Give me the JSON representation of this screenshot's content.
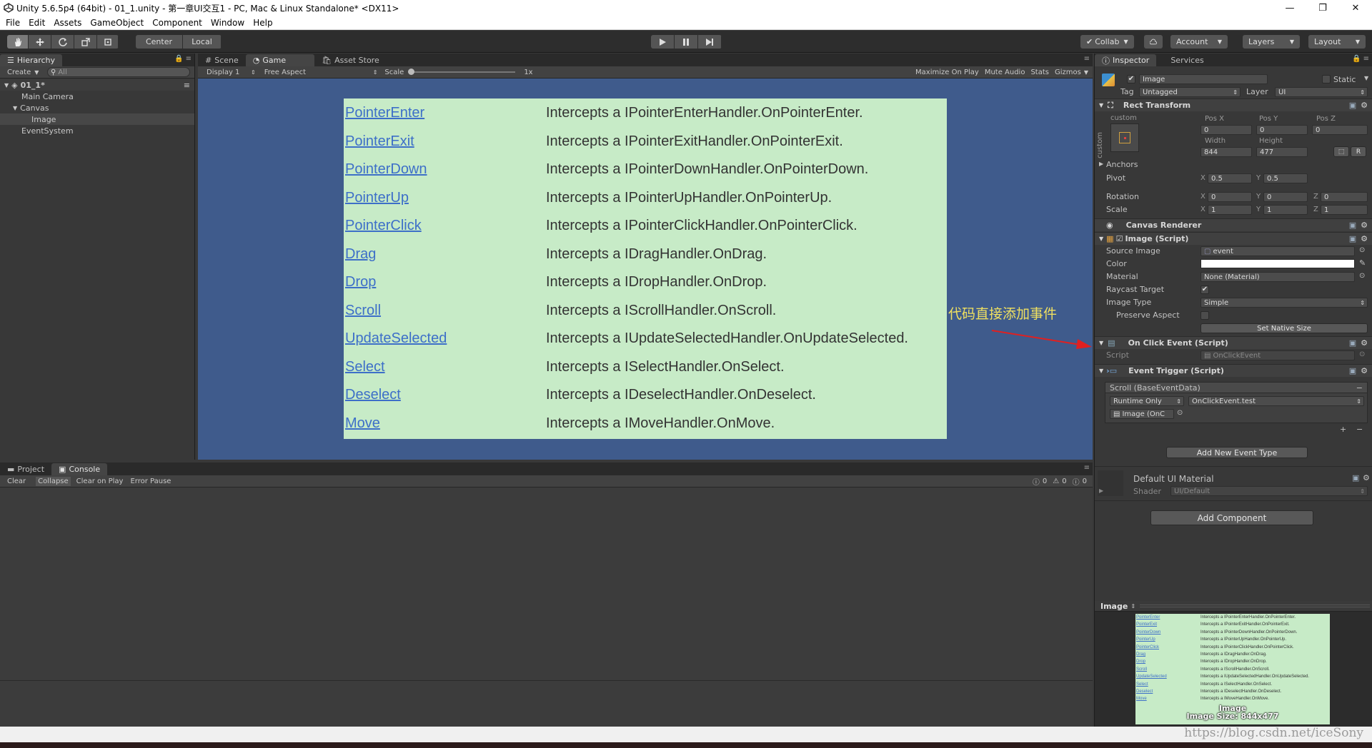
{
  "window": {
    "title": "Unity 5.6.5p4 (64bit) - 01_1.unity - 第一章UI交互1 - PC, Mac & Linux Standalone* <DX11>",
    "minimize": "—",
    "maximize": "❐",
    "close": "✕"
  },
  "menu": [
    "File",
    "Edit",
    "Assets",
    "GameObject",
    "Component",
    "Window",
    "Help"
  ],
  "toolbar": {
    "pivot_center": "Center",
    "pivot_local": "Local",
    "collab": "Collab",
    "account": "Account",
    "layers": "Layers",
    "layout": "Layout"
  },
  "hierarchy": {
    "tab": "Hierarchy",
    "create": "Create",
    "search_placeholder": "All",
    "scene": "01_1*",
    "items": [
      "Main Camera",
      "Canvas",
      "Image",
      "EventSystem"
    ]
  },
  "game": {
    "tabs": [
      "Scene",
      "Game",
      "Asset Store"
    ],
    "display": "Display 1",
    "aspect": "Free Aspect",
    "scale_label": "Scale",
    "scale_value": "1x",
    "maximize_on_play": "Maximize On Play",
    "mute_audio": "Mute Audio",
    "stats": "Stats",
    "gizmos": "Gizmos",
    "events": [
      {
        "name": "PointerEnter",
        "desc": "Intercepts a IPointerEnterHandler.OnPointerEnter."
      },
      {
        "name": "PointerExit",
        "desc": "Intercepts a IPointerExitHandler.OnPointerExit."
      },
      {
        "name": "PointerDown",
        "desc": "Intercepts a IPointerDownHandler.OnPointerDown."
      },
      {
        "name": "PointerUp",
        "desc": "Intercepts a IPointerUpHandler.OnPointerUp."
      },
      {
        "name": "PointerClick",
        "desc": "Intercepts a IPointerClickHandler.OnPointerClick."
      },
      {
        "name": "Drag",
        "desc": "Intercepts a IDragHandler.OnDrag."
      },
      {
        "name": "Drop",
        "desc": "Intercepts a IDropHandler.OnDrop."
      },
      {
        "name": "Scroll",
        "desc": "Intercepts a IScrollHandler.OnScroll."
      },
      {
        "name": "UpdateSelected",
        "desc": "Intercepts a IUpdateSelectedHandler.OnUpdateSelected."
      },
      {
        "name": "Select",
        "desc": "Intercepts a ISelectHandler.OnSelect."
      },
      {
        "name": "Deselect",
        "desc": "Intercepts a IDeselectHandler.OnDeselect."
      },
      {
        "name": "Move",
        "desc": "Intercepts a IMoveHandler.OnMove."
      }
    ],
    "annotation": "代码直接添加事件"
  },
  "console": {
    "tabs": [
      "Project",
      "Console"
    ],
    "buttons": [
      "Clear",
      "Collapse",
      "Clear on Play",
      "Error Pause"
    ],
    "counts": {
      "info": "0",
      "warn": "0",
      "error": "0"
    }
  },
  "inspector": {
    "tabs": [
      "Inspector",
      "Services"
    ],
    "object_name": "Image",
    "static": "Static",
    "tag_label": "Tag",
    "tag": "Untagged",
    "layer_label": "Layer",
    "layer": "UI",
    "rect_transform": {
      "title": "Rect Transform",
      "anchor_preset": "custom",
      "side_label": "custom",
      "posx_label": "Pos X",
      "posy_label": "Pos Y",
      "posz_label": "Pos Z",
      "posx": "0",
      "posy": "0",
      "posz": "0",
      "width_label": "Width",
      "height_label": "Height",
      "width": "844",
      "height": "477",
      "anchors": "Anchors",
      "pivot_label": "Pivot",
      "pivot_x": "0.5",
      "pivot_y": "0.5",
      "rotation_label": "Rotation",
      "rot_x": "0",
      "rot_y": "0",
      "rot_z": "0",
      "scale_label": "Scale",
      "scale_x": "1",
      "scale_y": "1",
      "scale_z": "1",
      "x": "X",
      "y": "Y",
      "z": "Z",
      "raw": "R"
    },
    "canvas_renderer": "Canvas Renderer",
    "image_script": {
      "title": "Image (Script)",
      "source_image_label": "Source Image",
      "source_image": "event",
      "color_label": "Color",
      "material_label": "Material",
      "material": "None (Material)",
      "raycast_label": "Raycast Target",
      "image_type_label": "Image Type",
      "image_type": "Simple",
      "preserve_label": "Preserve Aspect",
      "native_size": "Set Native Size"
    },
    "onclick_script": {
      "title": "On Click Event (Script)",
      "script_label": "Script",
      "script": "OnClickEvent"
    },
    "event_trigger": {
      "title": "Event Trigger (Script)",
      "entry": "Scroll (BaseEventData)",
      "runtime": "Runtime Only",
      "function": "OnClickEvent.test",
      "target": "Image (OnC",
      "plus": "+",
      "minus": "−",
      "add_new": "Add New Event Type"
    },
    "material": {
      "title": "Default UI Material",
      "shader_label": "Shader",
      "shader": "UI/Default"
    },
    "add_component": "Add Component",
    "preview": {
      "title": "Image",
      "caption1": "Image",
      "caption2": "Image Size: 844x477"
    }
  },
  "watermark": "https://blog.csdn.net/iceSony"
}
